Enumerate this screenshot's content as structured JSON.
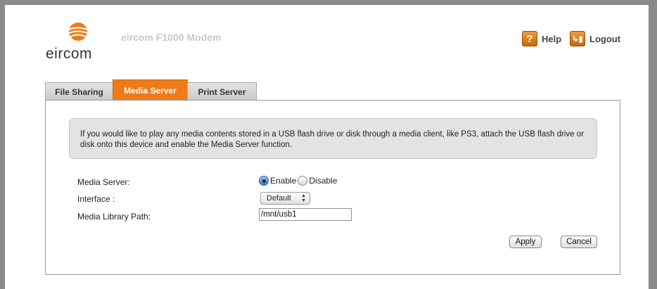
{
  "header": {
    "brand_name": "eircom",
    "modem_title": "eircom F1000 Modem",
    "help_label": "Help",
    "help_icon": "?",
    "logout_label": "Logout",
    "logout_icon": "↳▮"
  },
  "tabs": [
    {
      "label": "File Sharing",
      "active": false
    },
    {
      "label": "Media Server",
      "active": true
    },
    {
      "label": "Print Server",
      "active": false
    }
  ],
  "info_text": "If you would like to play any media contents stored in a USB flash drive or disk through a media client, like PS3, attach the USB flash drive or disk onto this device and enable the Media Server function.",
  "form": {
    "media_server_label": "Media Server:",
    "enable_label": "Enable",
    "disable_label": "Disable",
    "selected_option": "Enable",
    "interface_label": "Interface :",
    "interface_value": "Default",
    "library_path_label": "Media Library Path:",
    "library_path_value": "/mnt/usb1"
  },
  "buttons": {
    "apply_label": "Apply",
    "cancel_label": "Cancel"
  },
  "colors": {
    "accent": "#ee7b18",
    "frame": "#8a8a8a"
  }
}
